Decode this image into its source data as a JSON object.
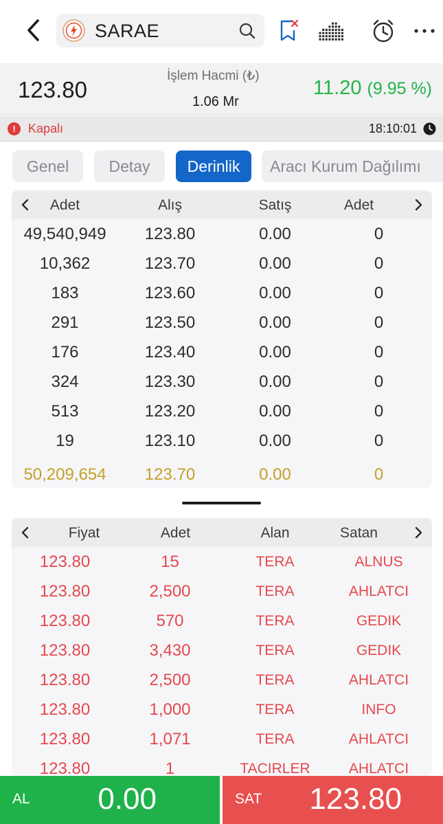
{
  "header": {
    "symbol": "SARAE",
    "icons": [
      "back-icon",
      "search-icon",
      "bookmark-icon",
      "depth-chart-icon",
      "alarm-clock-icon",
      "more-icon"
    ]
  },
  "price": {
    "last": "123.80",
    "volume_label": "İşlem Hacmi (₺)",
    "volume_value": "1.06 Mr",
    "change": "11.20",
    "change_pct": "(9.95 %)",
    "up_color": "#22b34a"
  },
  "status": {
    "text": "Kapalı",
    "time": "18:10:01",
    "closed_color": "#e03a3a"
  },
  "tabs": [
    {
      "label": "Genel",
      "active": false
    },
    {
      "label": "Detay",
      "active": false
    },
    {
      "label": "Derinlik",
      "active": true
    },
    {
      "label": "Aracı Kurum Dağılımı",
      "active": false
    }
  ],
  "depth": {
    "headers": [
      "Adet",
      "Alış",
      "Satış",
      "Adet"
    ],
    "rows": [
      [
        "49,540,949",
        "123.80",
        "0.00",
        "0"
      ],
      [
        "10,362",
        "123.70",
        "0.00",
        "0"
      ],
      [
        "183",
        "123.60",
        "0.00",
        "0"
      ],
      [
        "291",
        "123.50",
        "0.00",
        "0"
      ],
      [
        "176",
        "123.40",
        "0.00",
        "0"
      ],
      [
        "324",
        "123.30",
        "0.00",
        "0"
      ],
      [
        "513",
        "123.20",
        "0.00",
        "0"
      ],
      [
        "19",
        "123.10",
        "0.00",
        "0"
      ]
    ],
    "total": [
      "50,209,654",
      "123.70",
      "0.00",
      "0"
    ]
  },
  "trades": {
    "headers": [
      "Fiyat",
      "Adet",
      "Alan",
      "Satan"
    ],
    "rows": [
      [
        "123.80",
        "15",
        "TERA",
        "ALNUS"
      ],
      [
        "123.80",
        "2,500",
        "TERA",
        "AHLATCI"
      ],
      [
        "123.80",
        "570",
        "TERA",
        "GEDIK"
      ],
      [
        "123.80",
        "3,430",
        "TERA",
        "GEDIK"
      ],
      [
        "123.80",
        "2,500",
        "TERA",
        "AHLATCI"
      ],
      [
        "123.80",
        "1,000",
        "TERA",
        "INFO"
      ],
      [
        "123.80",
        "1,071",
        "TERA",
        "AHLATCI"
      ],
      [
        "123.80",
        "1",
        "TACIRLER",
        "AHLATCI"
      ]
    ]
  },
  "actions": {
    "buy_label": "AL",
    "buy_value": "0.00",
    "sell_label": "SAT",
    "sell_value": "123.80",
    "buy_color": "#1fb24a",
    "sell_color": "#e84f4f"
  }
}
